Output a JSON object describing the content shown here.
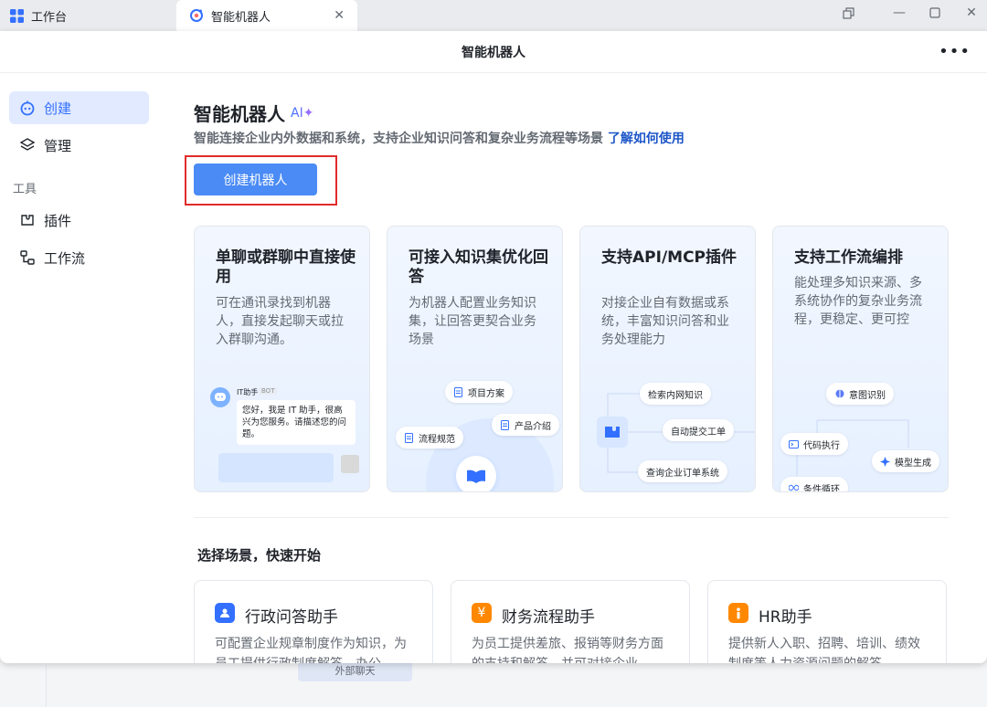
{
  "tabs": [
    {
      "label": "工作台"
    },
    {
      "label": "智能机器人"
    }
  ],
  "window": {
    "title": "智能机器人"
  },
  "sidebar": {
    "items": [
      {
        "label": "创建"
      },
      {
        "label": "管理"
      }
    ],
    "section_label": "工具",
    "tool_items": [
      {
        "label": "插件"
      },
      {
        "label": "工作流"
      }
    ]
  },
  "main": {
    "title": "智能机器人",
    "ai_badge": "AI✦",
    "subtitle": "智能连接企业内外数据和系统，支持企业知识问答和复杂业务流程等场景",
    "learn_more": "了解如何使用",
    "create_button": "创建机器人",
    "cards": [
      {
        "title": "单聊或群聊中直接使用",
        "desc": "可在通讯录找到机器人，直接发起聊天或拉入群聊沟通。",
        "bot_name": "IT助手",
        "bot_tag": "BOT",
        "bubble": "您好，我是 IT 助手，很高兴为您服务。请描述您的问题。"
      },
      {
        "title": "可接入知识集优化回答",
        "desc": "为机器人配置业务知识集，让回答更契合业务场景",
        "chips": [
          "项目方案",
          "产品介绍",
          "流程规范"
        ]
      },
      {
        "title": "支持API/MCP插件",
        "desc": "对接企业自有数据或系统，丰富知识问答和业务处理能力",
        "chips": [
          "检索内网知识",
          "自动提交工单",
          "查询企业订单系统"
        ]
      },
      {
        "title": "支持工作流编排",
        "desc": "能处理多知识来源、多系统协作的复杂业务流程，更稳定、更可控",
        "chips": [
          "意图识别",
          "代码执行",
          "模型生成",
          "条件循环"
        ]
      }
    ],
    "section_title": "选择场景，快速开始",
    "scenes": [
      {
        "name": "行政问答助手",
        "desc": "可配置企业规章制度作为知识，为员工提供行政制度解答、办公",
        "color": "#3370ff"
      },
      {
        "name": "财务流程助手",
        "desc": "为员工提供差旅、报销等财务方面的支持和解答，并可对接企业",
        "color": "#ff8800"
      },
      {
        "name": "HR助手",
        "desc": "提供新人入职、招聘、培训、绩效制度等人力资源问题的解答",
        "color": "#ff8800"
      }
    ]
  },
  "background": {
    "chip_label": "外部聊天"
  }
}
